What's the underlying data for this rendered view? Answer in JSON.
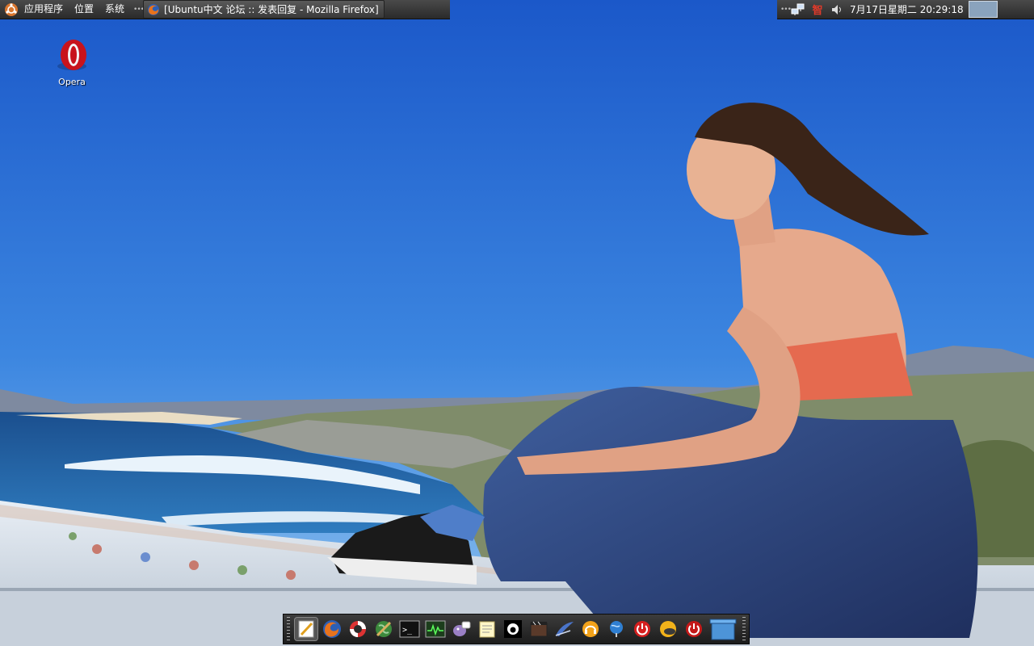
{
  "panel": {
    "menus": [
      "应用程序",
      "位置",
      "系统"
    ],
    "active_window_title": "[Ubuntu中文 论坛 :: 发表回复 - Mozilla Firefox]",
    "input_method_glyph": "智",
    "clock": "7月17日星期二  20:29:18"
  },
  "desktop": {
    "icons": [
      {
        "label": "Opera",
        "icon": "opera-icon"
      }
    ]
  },
  "dock": {
    "items": [
      "text-editor-icon",
      "firefox-icon",
      "help-lifebuoy-icon",
      "browser-globe-icon",
      "terminal-icon",
      "system-monitor-icon",
      "pidgin-chat-icon",
      "notes-icon",
      "amarok-icon",
      "video-player-icon",
      "email-client-icon",
      "music-headphones-icon",
      "network-globe-icon",
      "shutdown-icon",
      "weather-icon",
      "logout-power-icon",
      "trash-icon"
    ]
  }
}
